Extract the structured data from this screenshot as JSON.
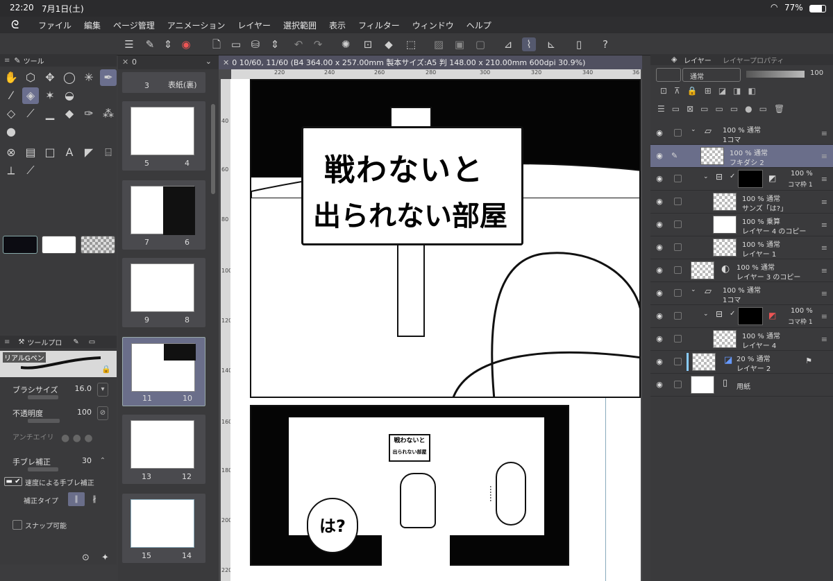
{
  "status": {
    "time": "22:20",
    "date": "7月1日(土)",
    "battery": "77%"
  },
  "menu": [
    "ファイル",
    "編集",
    "ページ管理",
    "アニメーション",
    "レイヤー",
    "選択範囲",
    "表示",
    "フィルター",
    "ウィンドウ",
    "ヘルプ"
  ],
  "tool_panel": {
    "tab": "ツール"
  },
  "tool_property": {
    "tab": "ツールプロ",
    "brush_name": "リアルGペン",
    "brush_size_label": "ブラシサイズ",
    "brush_size_value": "16.0",
    "opacity_label": "不透明度",
    "opacity_value": "100",
    "antialias_label": "アンチエイリ",
    "stabilization_label": "手ブレ補正",
    "stabilization_value": "30",
    "speed_stab_label": "速度による手ブレ補正",
    "stab_type_label": "補正タイプ",
    "snap_label": "スナップ可能"
  },
  "pages_panel": {
    "tab_value": "0",
    "pages": [
      {
        "left": "3",
        "right": "表紙(裏)"
      },
      {
        "left": "5",
        "right": "4"
      },
      {
        "left": "7",
        "right": "6"
      },
      {
        "left": "9",
        "right": "8"
      },
      {
        "left": "11",
        "right": "10",
        "selected": true
      },
      {
        "left": "13",
        "right": "12"
      },
      {
        "left": "15",
        "right": "14"
      }
    ]
  },
  "canvas": {
    "tab_title": "0 10/60, 11/60 (B4 364.00 x 257.00mm 製本サイズ:A5 判 148.00 x 210.00mm 600dpi 30.9%)",
    "ruler_top": [
      "220",
      "240",
      "260",
      "280",
      "300",
      "320",
      "340",
      "36"
    ],
    "ruler_left": [
      "40",
      "60",
      "80",
      "100",
      "120",
      "140",
      "160",
      "180",
      "200",
      "220"
    ],
    "sign_line1": "戦わないと",
    "sign_line2": "出られない部屋",
    "bubble1": "……",
    "bubble2": "は?"
  },
  "layers_panel": {
    "tab1": "レイヤー",
    "tab2": "レイヤープロパティ",
    "blend_mode": "通常",
    "opacity": "100",
    "layers": [
      {
        "op": "100 % 通常",
        "name": "1コマ",
        "type": "folder"
      },
      {
        "op": "100 % 通常",
        "name": "フキダシ 2",
        "selected": true
      },
      {
        "op": "100 %",
        "name": "コマ枠 1",
        "type": "frame"
      },
      {
        "op": "100 % 通常",
        "name": "サンズ「は?」"
      },
      {
        "op": "100 % 乗算",
        "name": "レイヤー 4 のコピー"
      },
      {
        "op": "100 % 通常",
        "name": "レイヤー 1"
      },
      {
        "op": "100 % 通常",
        "name": "レイヤー 3 のコピー"
      },
      {
        "op": "100 % 通常",
        "name": "1コマ",
        "type": "folder"
      },
      {
        "op": "100 %",
        "name": "コマ枠 1",
        "type": "frame"
      },
      {
        "op": "100 % 通常",
        "name": "レイヤー 4"
      },
      {
        "op": "20 % 通常",
        "name": "レイヤー 2"
      },
      {
        "op": "",
        "name": "用紙"
      }
    ]
  }
}
